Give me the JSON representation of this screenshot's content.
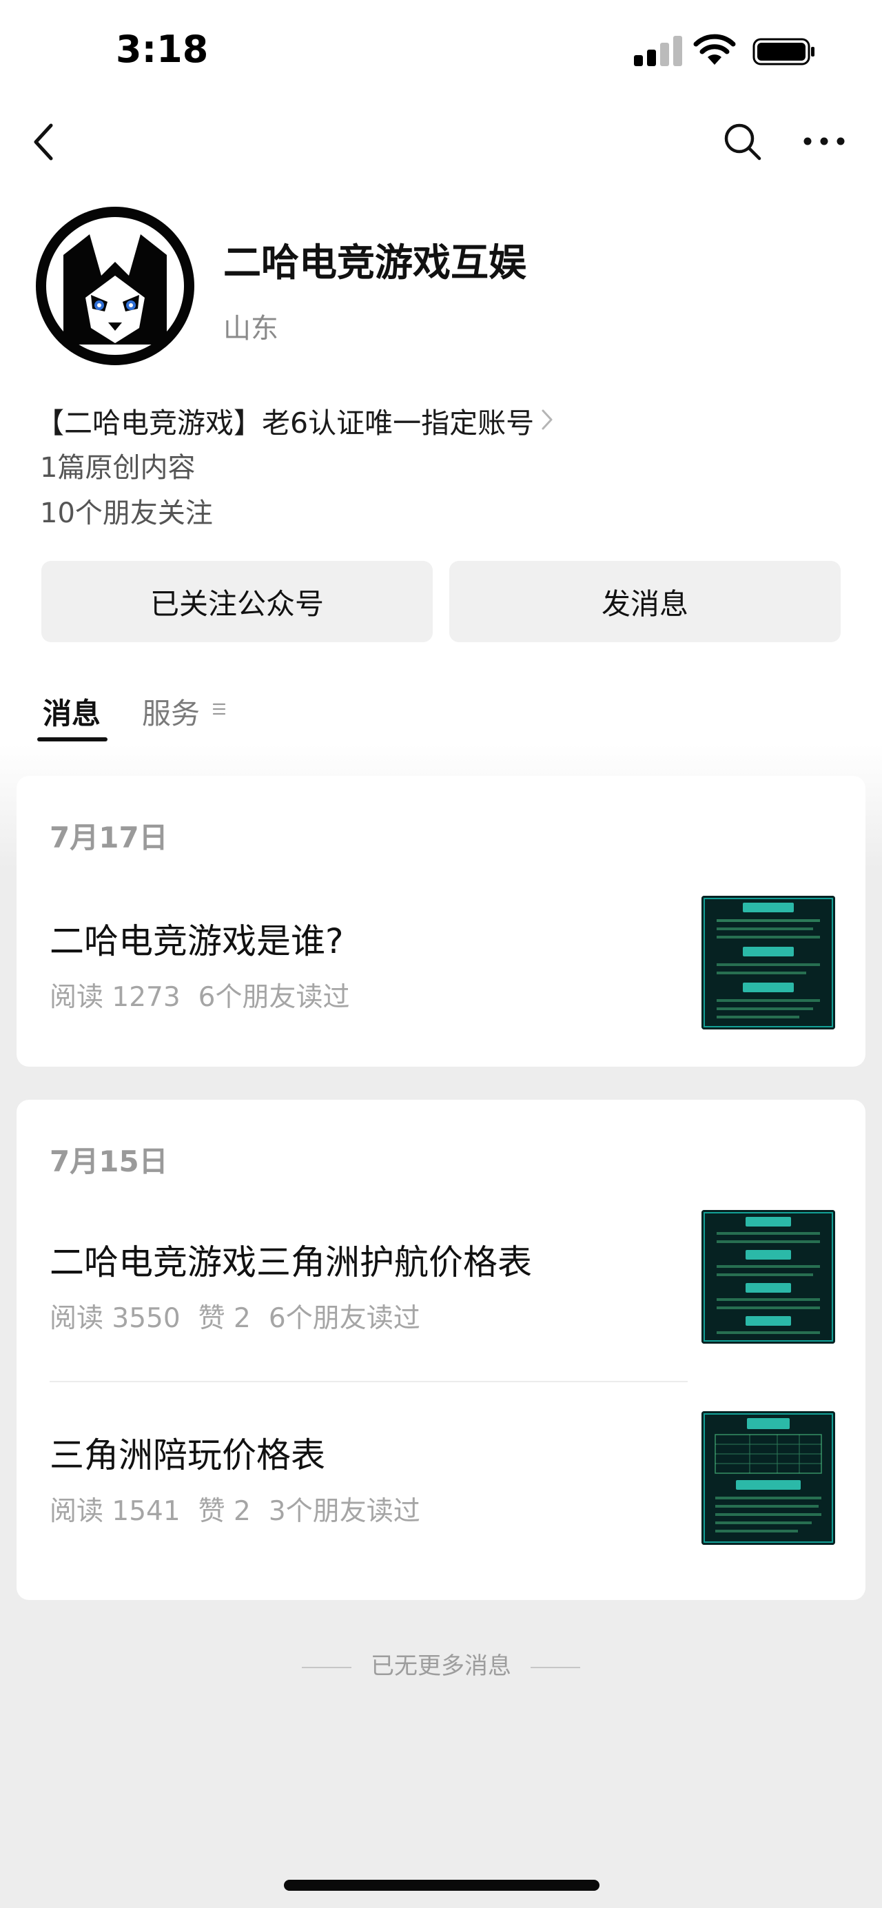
{
  "status_bar": {
    "time": "3:18"
  },
  "profile": {
    "name": "二哈电竞游戏互娱",
    "region": "山东",
    "description": "【二哈电竞游戏】老6认证唯一指定账号",
    "original_count": "1篇原创内容",
    "friends_following": "10个朋友关注"
  },
  "actions": {
    "following_label": "已关注公众号",
    "message_label": "发消息"
  },
  "tabs": [
    {
      "label": "消息",
      "active": true
    },
    {
      "label": "服务",
      "active": false
    }
  ],
  "messages": [
    {
      "date": "7月17日",
      "articles": [
        {
          "title": "二哈电竞游戏是谁?",
          "reads": "阅读 1273",
          "likes": "",
          "friends": "6个朋友读过"
        }
      ]
    },
    {
      "date": "7月15日",
      "articles": [
        {
          "title": "二哈电竞游戏三角洲护航价格表",
          "reads": "阅读 3550",
          "likes": "赞 2",
          "friends": "6个朋友读过"
        },
        {
          "title": "三角洲陪玩价格表",
          "reads": "阅读 1541",
          "likes": "赞 2",
          "friends": "3个朋友读过"
        }
      ]
    }
  ],
  "footer": {
    "end_note": "已无更多消息"
  },
  "colors": {
    "accent_text": "#111111",
    "meta_gray": "#a5a5a5",
    "thumb_bg": "#072626",
    "thumb_glow": "#19d6c8"
  }
}
